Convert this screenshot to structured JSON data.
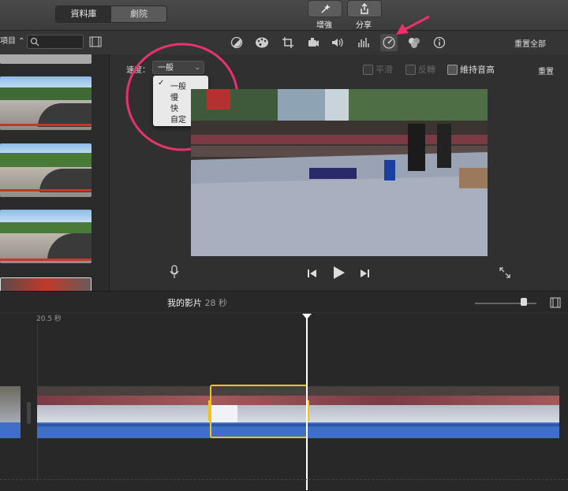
{
  "topbar": {
    "tabs": [
      "資料庫",
      "劇院"
    ],
    "enhance_label": "增強",
    "share_label": "分享"
  },
  "library": {
    "selector_label": "項目"
  },
  "toolbar": {
    "tools": [
      "color-balance-icon",
      "color-palette-icon",
      "crop-icon",
      "stabilize-icon",
      "volume-icon",
      "equalizer-icon",
      "speed-icon",
      "filter-icon",
      "info-icon"
    ],
    "reset_all_label": "重置全部"
  },
  "speed": {
    "label": "速度：",
    "selected": "一般",
    "options": [
      "一般",
      "慢",
      "快",
      "自定"
    ],
    "checkbox_smooth": "平滑",
    "checkbox_reverse": "反轉",
    "checkbox_preserve_pitch": "維持音高",
    "reset_label": "重置"
  },
  "timeline": {
    "project_name": "我的影片",
    "project_duration": "28 秒",
    "clip_duration": "20.5 秒"
  },
  "colors": {
    "accent": "#f0c419",
    "annotation": "#e8326b",
    "audio": "#3f6fc6"
  }
}
